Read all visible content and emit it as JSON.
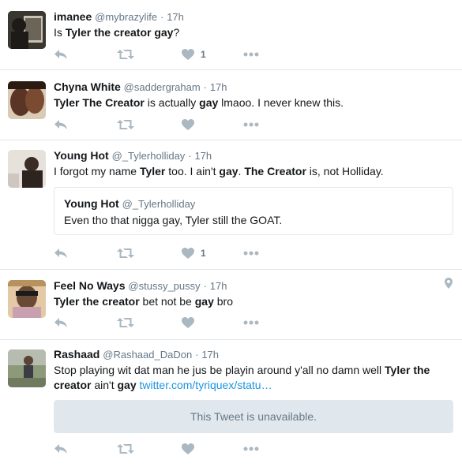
{
  "tweets": [
    {
      "name": "imanee",
      "handle": "@mybrazylife",
      "time": "17h",
      "text": [
        [
          "Is ",
          false
        ],
        [
          "Tyler the creator gay",
          true
        ],
        [
          "?",
          false
        ]
      ],
      "like_count": "1"
    },
    {
      "name": "Chyna White",
      "handle": "@saddergraham",
      "time": "17h",
      "text": [
        [
          "Tyler The Creator",
          true
        ],
        [
          " is actually ",
          false
        ],
        [
          "gay",
          true
        ],
        [
          " lmaoo. I never knew this.",
          false
        ]
      ],
      "like_count": ""
    },
    {
      "name": "Young Hot",
      "handle": "@_Tylerholliday",
      "time": "17h",
      "text": [
        [
          "I forgot my name ",
          false
        ],
        [
          "Tyler",
          true
        ],
        [
          " too. I ain't ",
          false
        ],
        [
          "gay",
          true
        ],
        [
          ". ",
          false
        ],
        [
          "The Creator",
          true
        ],
        [
          " is, not Holliday.",
          false
        ]
      ],
      "quote": {
        "name": "Young Hot",
        "handle": "@_Tylerholliday",
        "text": "Even tho that nigga gay, Tyler still the GOAT."
      },
      "like_count": "1"
    },
    {
      "name": "Feel No Ways",
      "handle": "@stussy_pussy",
      "time": "17h",
      "text": [
        [
          "Tyler the creator",
          true
        ],
        [
          " bet not be ",
          false
        ],
        [
          "gay",
          true
        ],
        [
          " bro",
          false
        ]
      ],
      "like_count": ""
    },
    {
      "name": "Rashaad",
      "handle": "@Rashaad_DaDon",
      "time": "17h",
      "text_line1": [
        [
          "Stop playing wit dat man he jus be playin around y'all no damn well ",
          false
        ],
        [
          "Tyler the",
          true
        ]
      ],
      "text_line2": [
        [
          "creator",
          true
        ],
        [
          " ain't ",
          false
        ],
        [
          "gay",
          true
        ],
        [
          " ",
          false
        ]
      ],
      "link": "twitter.com/tyriquex/statu…",
      "unavailable": "This Tweet is unavailable.",
      "like_count": ""
    }
  ],
  "colors": {
    "text": "#14171a",
    "secondary": "#657786",
    "link": "#1b95e0",
    "border": "#e1e8ed",
    "icon": "#aab8c2"
  },
  "icons": [
    "reply-icon",
    "retweet-icon",
    "like-icon",
    "more-icon",
    "location-pin-icon"
  ]
}
